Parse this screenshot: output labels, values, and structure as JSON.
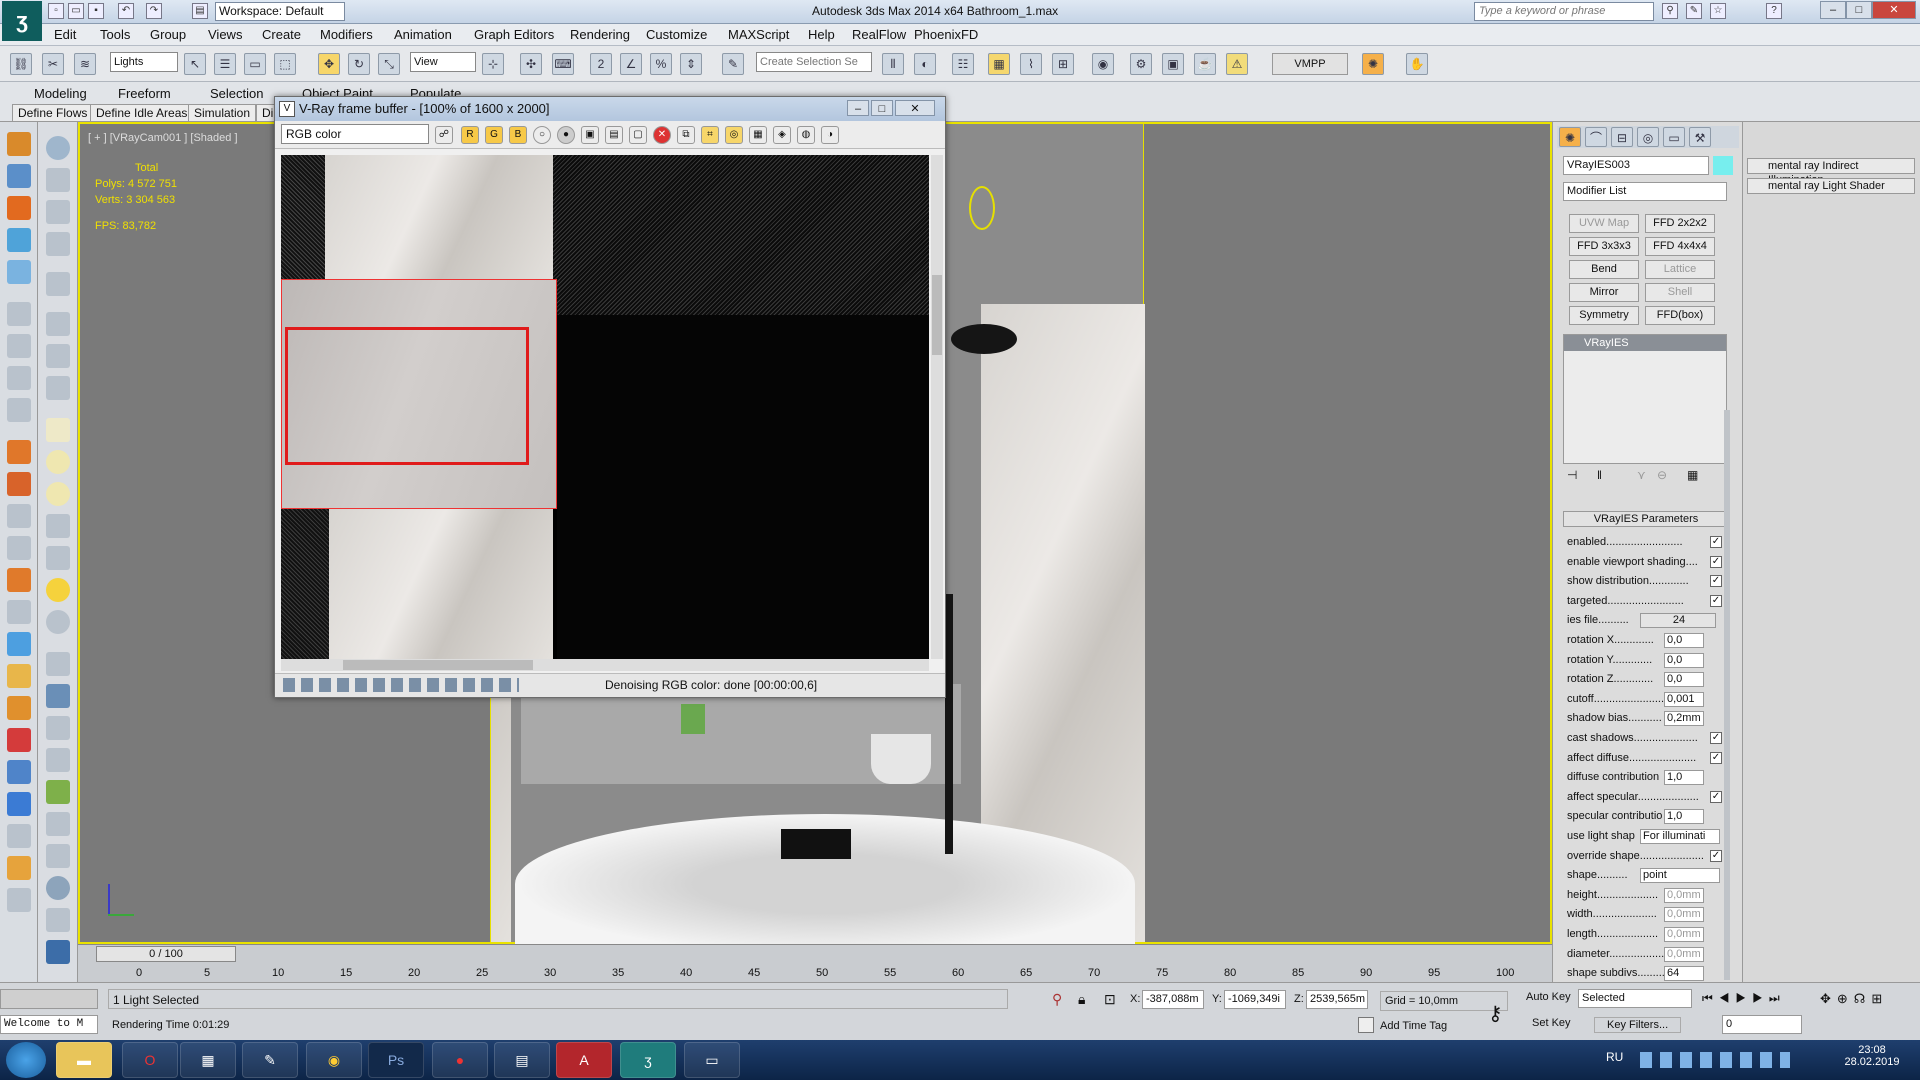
{
  "titlebar": {
    "workspace": "Workspace: Default",
    "title": "Autodesk 3ds Max  2014 x64     Bathroom_1.max",
    "search_placeholder": "Type a keyword or phrase"
  },
  "menus": [
    "Edit",
    "Tools",
    "Group",
    "Views",
    "Create",
    "Modifiers",
    "Animation",
    "Graph Editors",
    "Rendering",
    "Customize",
    "MAXScript",
    "Help",
    "RealFlow",
    "PhoenixFD"
  ],
  "toolbar": {
    "filter": "Lights",
    "refcoord": "View",
    "selset": "Create Selection Se",
    "vmpp": "VMPP"
  },
  "ribbon": {
    "tabs": [
      "Modeling",
      "Freeform",
      "Selection",
      "Object Paint",
      "Populate"
    ],
    "buttons": [
      "Define Flows",
      "Define Idle Areas",
      "Simulation",
      "Di"
    ]
  },
  "viewport": {
    "label": "[ + ] [VRayCam001 ] [Shaded ]",
    "total": "Total",
    "polys_label": "Polys:",
    "polys": "4 572 751",
    "verts_label": "Verts:",
    "verts": "3 304 563",
    "fps_label": "FPS:",
    "fps": "83,782"
  },
  "vfb": {
    "title": "V-Ray frame buffer - [100% of 1600 x 2000]",
    "channel": "RGB color",
    "status": "Denoising RGB color: done [00:00:00,6]"
  },
  "cmd": {
    "object_name": "VRayIES003",
    "modifier_list": "Modifier List",
    "modifiers": [
      "UVW Map",
      "FFD 2x2x2",
      "FFD 3x3x3",
      "FFD 4x4x4",
      "Bend",
      "Lattice",
      "Mirror",
      "Shell",
      "Symmetry",
      "FFD(box)"
    ],
    "stack_item": "VRayIES",
    "rollout_title": "VRayIES Parameters"
  },
  "params": [
    {
      "label": "enabled.........................",
      "type": "check",
      "value": "✓"
    },
    {
      "label": "enable viewport shading....",
      "type": "check",
      "value": "✓"
    },
    {
      "label": "show distribution.............",
      "type": "check",
      "value": "✓"
    },
    {
      "label": "targeted.........................",
      "type": "check",
      "value": "✓"
    },
    {
      "label": "ies file..........",
      "type": "field",
      "value": "24"
    },
    {
      "label": "rotation X.............",
      "type": "spin",
      "value": "0,0"
    },
    {
      "label": "rotation Y.............",
      "type": "spin",
      "value": "0,0"
    },
    {
      "label": "rotation Z.............",
      "type": "spin",
      "value": "0,0"
    },
    {
      "label": "cutoff.......................",
      "type": "spin",
      "value": "0,001"
    },
    {
      "label": "shadow bias...........",
      "type": "spin",
      "value": "0,2mm"
    },
    {
      "label": "cast shadows.....................",
      "type": "check",
      "value": "✓"
    },
    {
      "label": "affect diffuse......................",
      "type": "check",
      "value": "✓"
    },
    {
      "label": "diffuse contribution",
      "type": "spin",
      "value": "1,0"
    },
    {
      "label": "affect specular....................",
      "type": "check",
      "value": "✓"
    },
    {
      "label": "specular contributio",
      "type": "spin",
      "value": "1,0"
    },
    {
      "label": "use light shap",
      "type": "drop",
      "value": "For illuminati"
    },
    {
      "label": "override shape.....................",
      "type": "check",
      "value": "✓"
    },
    {
      "label": "shape..........",
      "type": "drop",
      "value": "point"
    },
    {
      "label": "height....................",
      "type": "spin",
      "value": "0,0mm"
    },
    {
      "label": "width.....................",
      "type": "spin",
      "value": "0,0mm"
    },
    {
      "label": "length....................",
      "type": "spin",
      "value": "0,0mm"
    },
    {
      "label": "diameter..................",
      "type": "spin",
      "value": "0,0mm"
    },
    {
      "label": "shape subdivs.........",
      "type": "spin",
      "value": "64"
    }
  ],
  "rollouts": [
    "mental ray Indirect Illumination",
    "mental ray Light Shader"
  ],
  "timeline": {
    "slider": "0 / 100",
    "ticks": [
      "0",
      "5",
      "10",
      "15",
      "20",
      "25",
      "30",
      "35",
      "40",
      "45",
      "50",
      "55",
      "60",
      "65",
      "70",
      "75",
      "80",
      "85",
      "90",
      "95",
      "100"
    ]
  },
  "status": {
    "selected": "1 Light Selected",
    "render_time": "Rendering Time  0:01:29",
    "welcome": "Welcome to M",
    "x_label": "X:",
    "x": "-387,088m",
    "y_label": "Y:",
    "y": "-1069,349i",
    "z_label": "Z:",
    "z": "2539,565m",
    "grid": "Grid = 10,0mm",
    "add_time_tag": "Add Time Tag",
    "auto_key": "Auto Key",
    "set_key": "Set Key",
    "selected_mode": "Selected",
    "key_filters": "Key Filters...",
    "frame": "0"
  },
  "taskbar": {
    "lang": "RU",
    "time": "23:08",
    "date": "28.02.2019"
  }
}
